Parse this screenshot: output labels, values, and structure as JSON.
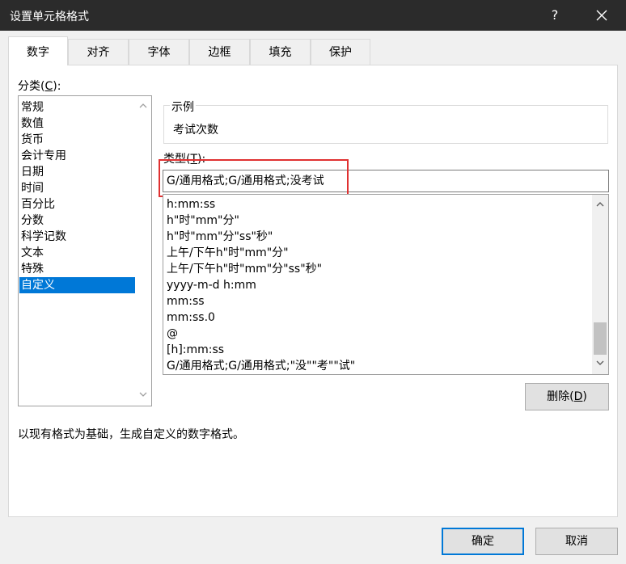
{
  "window": {
    "title": "设置单元格格式",
    "help_label": "?",
    "close_label": "✕"
  },
  "tabs": [
    {
      "label": "数字",
      "active": true
    },
    {
      "label": "对齐"
    },
    {
      "label": "字体"
    },
    {
      "label": "边框"
    },
    {
      "label": "填充"
    },
    {
      "label": "保护"
    }
  ],
  "category": {
    "label_text": "分类(",
    "label_key": "C",
    "label_suffix": "):",
    "items": [
      "常规",
      "数值",
      "货币",
      "会计专用",
      "日期",
      "时间",
      "百分比",
      "分数",
      "科学记数",
      "文本",
      "特殊",
      "自定义"
    ],
    "selected": "自定义"
  },
  "sample": {
    "legend": "示例",
    "value": "考试次数"
  },
  "type": {
    "label_text": "类型(",
    "label_key": "T",
    "label_suffix": "):",
    "value": "G/通用格式;G/通用格式;没考试"
  },
  "formats": [
    "h:mm:ss",
    "h\"时\"mm\"分\"",
    "h\"时\"mm\"分\"ss\"秒\"",
    "上午/下午h\"时\"mm\"分\"",
    "上午/下午h\"时\"mm\"分\"ss\"秒\"",
    "yyyy-m-d h:mm",
    "mm:ss",
    "mm:ss.0",
    "@",
    "[h]:mm:ss",
    "G/通用格式;G/通用格式;\"没\"\"考\"\"试\""
  ],
  "delete_button": {
    "label_text": "删除(",
    "label_key": "D",
    "label_suffix": ")"
  },
  "description": "以现有格式为基础，生成自定义的数字格式。",
  "buttons": {
    "ok": "确定",
    "cancel": "取消"
  },
  "colors": {
    "accent": "#0078d7",
    "highlight": "#e03131",
    "titlebar": "#2b2b2b"
  }
}
